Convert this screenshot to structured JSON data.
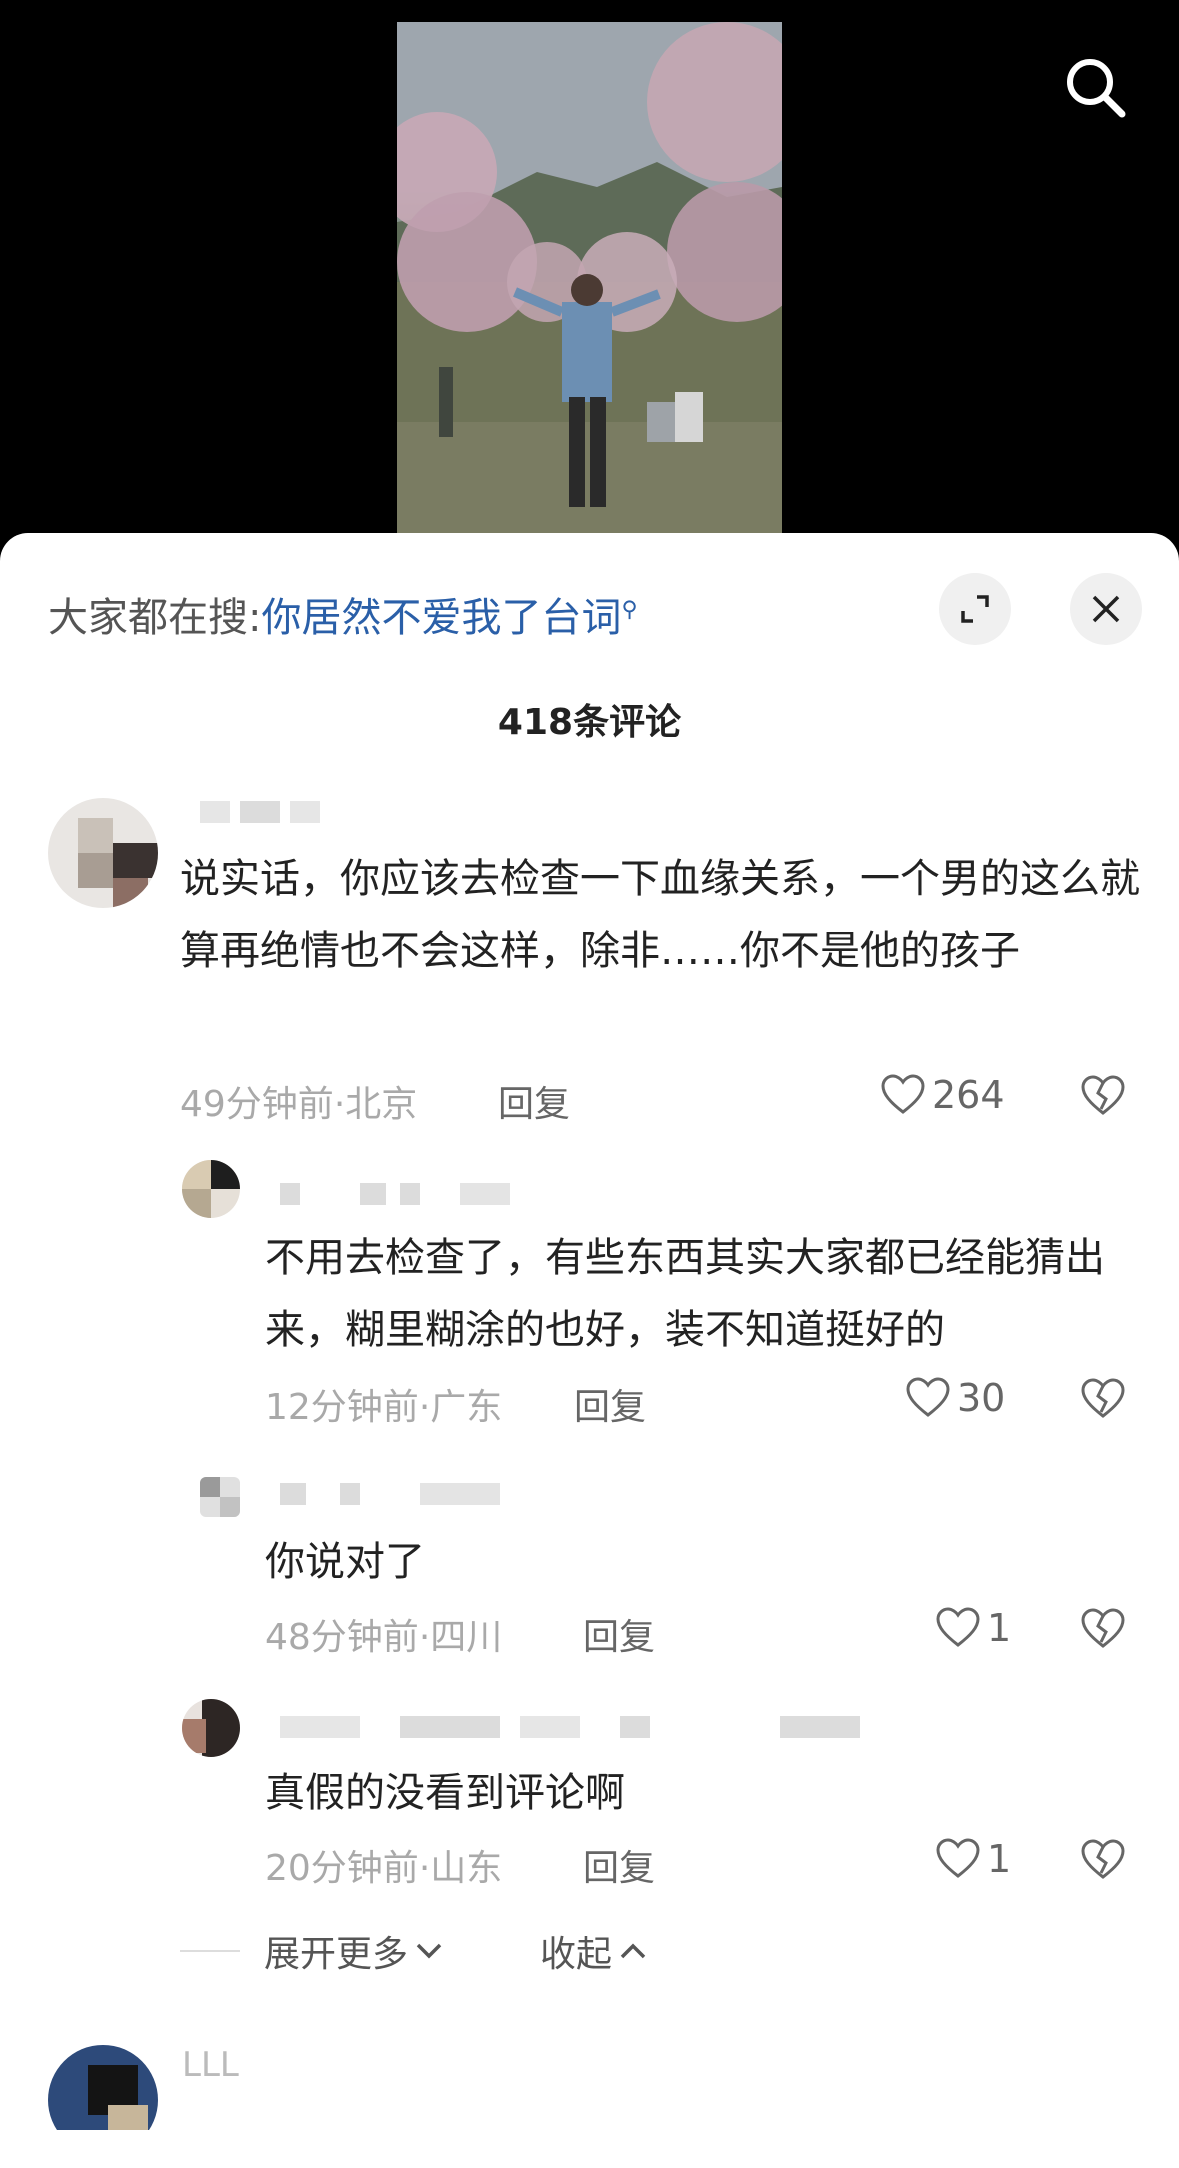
{
  "video": {
    "search_icon": "search-icon"
  },
  "sheet": {
    "trending_prefix": "大家都在搜:",
    "trending_query": "你居然不爱我了台词",
    "comment_count": "418条评论",
    "expand_icon": "expand-icon",
    "close_icon": "close-icon"
  },
  "comments": [
    {
      "text": "说实话，你应该去检查一下血缘关系，一个男的这么就算再绝情也不会这样，除非……你不是他的孩子",
      "time": "49分钟前",
      "location": "北京",
      "reply_label": "回复",
      "likes": "264"
    },
    {
      "text": "不用去检查了，有些东西其实大家都已经能猜出来，糊里糊涂的也好，装不知道挺好的",
      "time": "12分钟前",
      "location": "广东",
      "reply_label": "回复",
      "likes": "30"
    },
    {
      "text": "你说对了",
      "time": "48分钟前",
      "location": "四川",
      "reply_label": "回复",
      "likes": "1"
    },
    {
      "text": "真假的没看到评论啊",
      "time": "20分钟前",
      "location": "山东",
      "reply_label": "回复",
      "likes": "1"
    }
  ],
  "expand": {
    "more_label": "展开更多",
    "collapse_label": "收起"
  },
  "next_comment": {
    "username": "LLL"
  },
  "colors": {
    "trending_link": "#2a5fa8",
    "meta": "#a9a9a9",
    "sheet_bg": "#ffffff"
  }
}
